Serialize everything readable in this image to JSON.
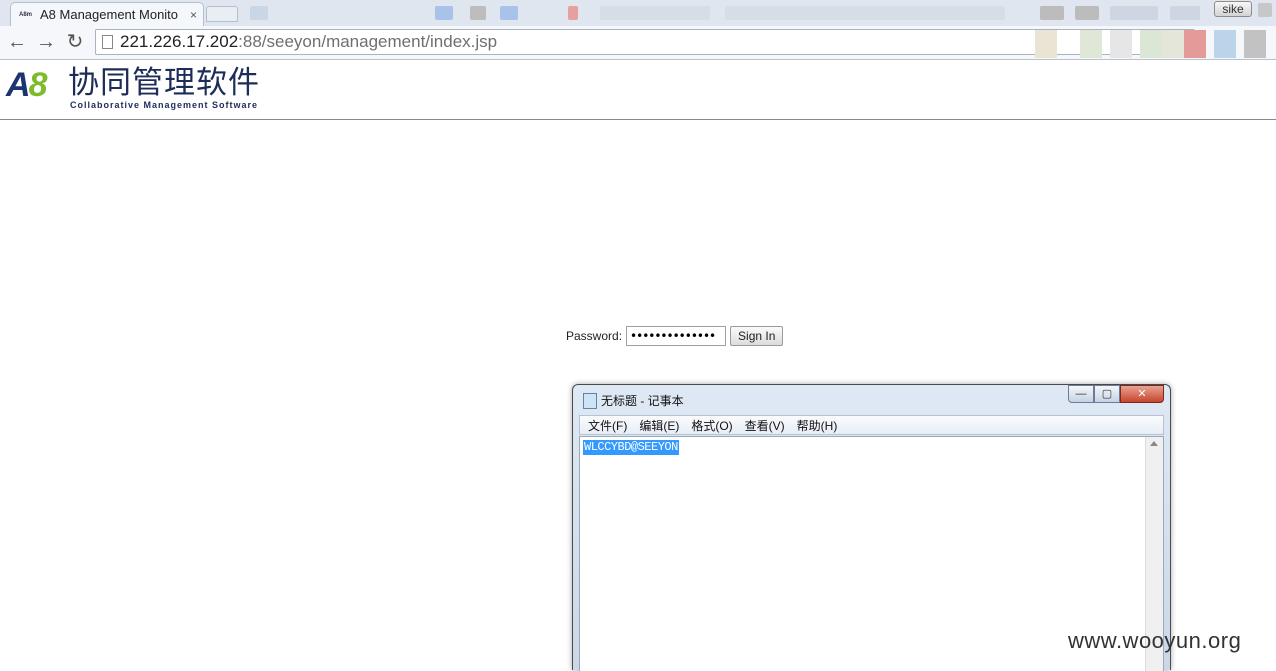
{
  "browser": {
    "tab_favicon": "A8m",
    "tab_title": "A8 Management Monito",
    "tab_close": "×",
    "user_badge": "sike",
    "back_icon": "←",
    "forward_icon": "→",
    "reload_icon": "↻",
    "url_host": "221.226.17.202",
    "url_path": ":88/seeyon/management/index.jsp"
  },
  "page": {
    "logo_mark_a": "A",
    "logo_mark_8": "8",
    "logo_title": "协同管理软件",
    "logo_subtitle": "Collaborative Management Software",
    "password_label": "Password:",
    "password_value": "••••••••••••••",
    "sign_in_label": "Sign In"
  },
  "notepad": {
    "title": "无标题 - 记事本",
    "minimize": "—",
    "maximize": "▢",
    "close": "✕",
    "menus": [
      "文件(F)",
      "编辑(E)",
      "格式(O)",
      "查看(V)",
      "帮助(H)"
    ],
    "content": "WLCCYBD@SEEYON"
  },
  "watermark": "www.wooyun.org",
  "colors": {
    "selection": "#3399ff",
    "logo_navy": "#1d2d58",
    "logo_green": "#7cbc2a"
  }
}
